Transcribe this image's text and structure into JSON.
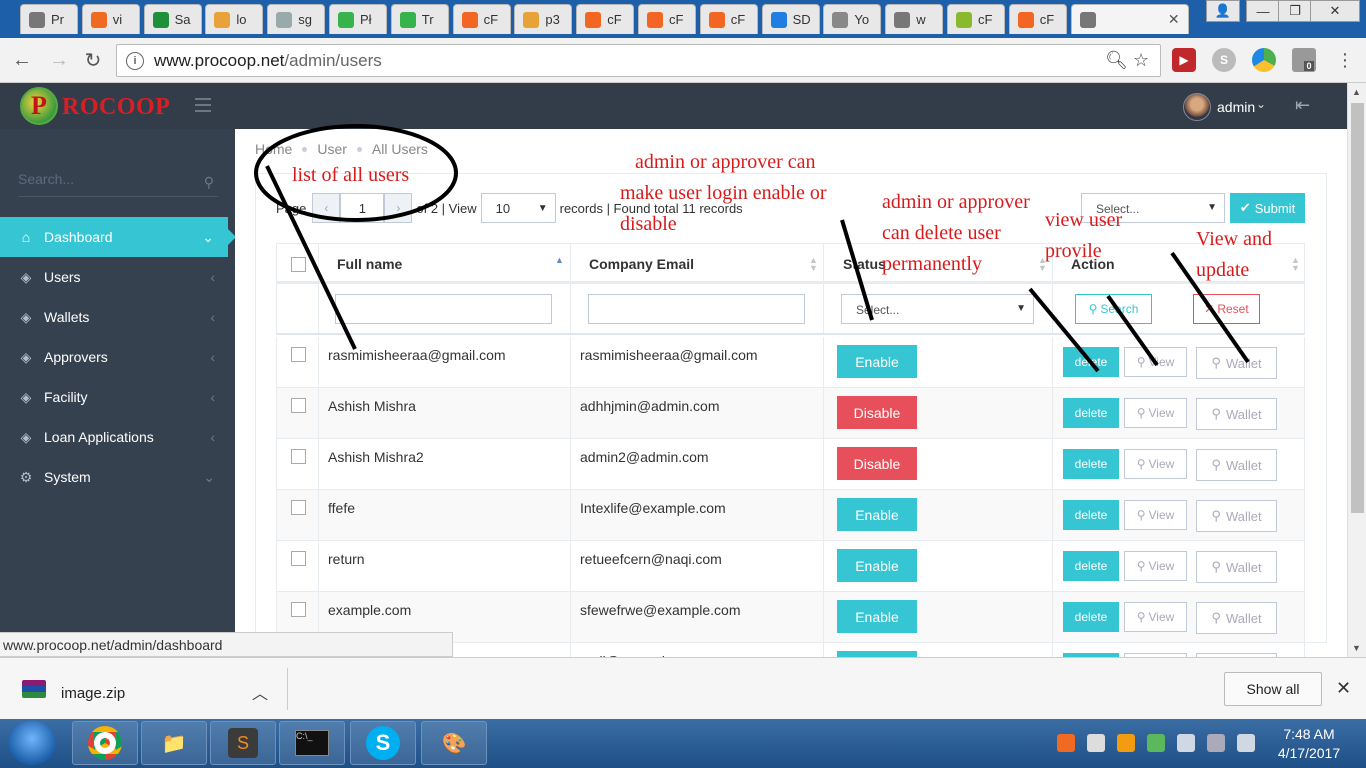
{
  "browser": {
    "tabs": [
      {
        "title": "Pr",
        "color": "#777"
      },
      {
        "title": "vi",
        "color": "#f16a22"
      },
      {
        "title": "Sa",
        "color": "#1e8f3a"
      },
      {
        "title": "lo",
        "color": "#e8a23a"
      },
      {
        "title": "sg",
        "color": "#9aa"
      },
      {
        "title": "Pł",
        "color": "#36b34a"
      },
      {
        "title": "Tr",
        "color": "#36b34a"
      },
      {
        "title": "cF",
        "color": "#f26522"
      },
      {
        "title": "p3",
        "color": "#e8a23a"
      },
      {
        "title": "cF",
        "color": "#f26522"
      },
      {
        "title": "cF",
        "color": "#f26522"
      },
      {
        "title": "cF",
        "color": "#f26522"
      },
      {
        "title": "SD",
        "color": "#1f7ee0"
      },
      {
        "title": "Yo",
        "color": "#888"
      },
      {
        "title": "w",
        "color": "#777"
      },
      {
        "title": "cF",
        "color": "#8bb92d"
      },
      {
        "title": "cF",
        "color": "#f26522"
      },
      {
        "title": "",
        "color": "#777"
      }
    ],
    "url_host": "www.procoop.net",
    "url_path": "/admin/users",
    "status_url": "www.procoop.net/admin/dashboard",
    "ext_badge": "0"
  },
  "app": {
    "logo_letter": "P",
    "logo_text": "ROCOOP",
    "user_name": "admin",
    "search_placeholder": "Search...",
    "sidebar": [
      {
        "label": "Dashboard",
        "icon": "home-icon",
        "active": true
      },
      {
        "label": "Users",
        "icon": "diamond-icon"
      },
      {
        "label": "Wallets",
        "icon": "diamond-icon"
      },
      {
        "label": "Approvers",
        "icon": "diamond-icon"
      },
      {
        "label": "Facility",
        "icon": "diamond-icon"
      },
      {
        "label": "Loan Applications",
        "icon": "diamond-icon"
      },
      {
        "label": "System",
        "icon": "gear-icon"
      }
    ],
    "breadcrumb": [
      "Home",
      "User",
      "All Users"
    ],
    "pager": {
      "page_label": "Page",
      "prev": "‹",
      "page": "1",
      "next": "›",
      "of_label": "of 2 | View",
      "per_page": "10",
      "summary": "records | Found total 11 records"
    },
    "bulk_select_placeholder": "Select...",
    "submit_label": "Submit",
    "columns": [
      "Full name",
      "Company Email",
      "Status",
      "Action"
    ],
    "status_filter_placeholder": "Select...",
    "search_label": "Search",
    "reset_label": "Reset",
    "delete_label": "delete",
    "view_label": "View",
    "wallet_label": "Wallet",
    "rows": [
      {
        "name": "rasmimisheeraa@gmail.com",
        "email": "rasmimisheeraa@gmail.com",
        "status": "Enable"
      },
      {
        "name": "Ashish Mishra",
        "email": "adhhjmin@admin.com",
        "status": "Disable"
      },
      {
        "name": "Ashish Mishra2",
        "email": "admin2@admin.com",
        "status": "Disable"
      },
      {
        "name": "ffefe",
        "email": "Intexlife@example.com",
        "status": "Enable"
      },
      {
        "name": "return",
        "email": "retueefcern@naqi.com",
        "status": "Enable"
      },
      {
        "name": "example.com",
        "email": "sfewefrwe@example.com",
        "status": "Enable"
      },
      {
        "name": "",
        "email": "mail@example.com",
        "status": "Enable"
      }
    ]
  },
  "downloads": {
    "file": "image.zip",
    "show_all": "Show all"
  },
  "taskbar": {
    "time": "7:48 AM",
    "date": "4/17/2017"
  },
  "annotations": {
    "list": "list of all users",
    "enable": [
      "admin or approver can",
      "make user login enable or",
      "disable"
    ],
    "delete": [
      "admin or approver",
      "can delete user",
      "permanently"
    ],
    "view": [
      "view user",
      "provile"
    ],
    "update": [
      "View and",
      "update"
    ]
  },
  "colors": {
    "accent": "#36c6d3",
    "danger": "#e7505a",
    "sidebar": "#364150",
    "header": "#333d4a",
    "annotation": "#d91a1a"
  }
}
